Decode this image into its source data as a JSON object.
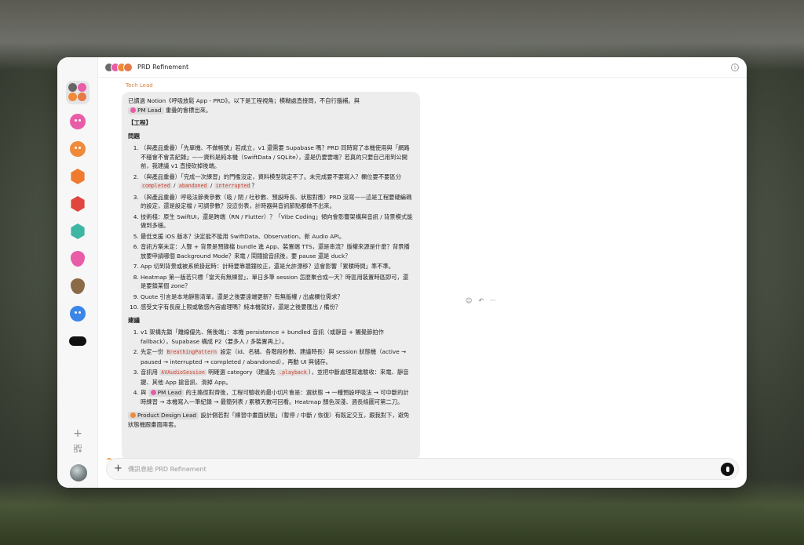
{
  "header": {
    "title": "PRD Refinement",
    "avatar_colors": [
      "#6b6b6b",
      "#e85ca8",
      "#ef8a3a",
      "#e57a45"
    ]
  },
  "sidebar": {
    "items": [
      {
        "name": "group-chat",
        "shape": "group",
        "colors": [
          "#666666",
          "#e85ca8",
          "#ef8a3a",
          "#e57a45"
        ],
        "active": true
      },
      {
        "name": "pm-lead",
        "shape": "blob",
        "color": "#e85ca8"
      },
      {
        "name": "product-design-lead",
        "shape": "blob",
        "color": "#ef8a3a"
      },
      {
        "name": "orange-hex",
        "shape": "hex",
        "color": "#ee7b2f"
      },
      {
        "name": "red-hex",
        "shape": "hex",
        "color": "#e0463e"
      },
      {
        "name": "teal-hex",
        "shape": "hex",
        "color": "#3db7a4"
      },
      {
        "name": "pink-drop",
        "shape": "drop",
        "color": "#e85ca8"
      },
      {
        "name": "brown-drop",
        "shape": "drop",
        "color": "#8b6b45"
      },
      {
        "name": "blue-blob",
        "shape": "blob",
        "color": "#3b86e8"
      },
      {
        "name": "black-pill",
        "shape": "pill",
        "color": "#111111"
      }
    ],
    "add_label": "+",
    "grid_icon": "grid-plus-icon"
  },
  "message": {
    "sender": "Tech Lead",
    "intro_before": "已讀過 Notion《呼吸放鬆 App - PRD》。以下是工程視角；模糊處直接問，不自行腦補。與",
    "intro_mention": "PM Lead",
    "intro_after": "重疊的會標出來。",
    "section_heading": "【工程】",
    "questions_heading": "問題",
    "questions": [
      [
        "（與產品重疊）「先單機、不做帳號」若成立，v1 還需要 Supabase 嗎？PRD 同時寫了本機使用與「網路不穩會不會丟紀錄」——資料是純本機（SwiftData / SQLite），還是仍要雲端？若真的只要自己用到公開前，我建議 v1 直接砍掉後端。"
      ],
      [
        "（與產品重疊）「完成一次練習」的門檻沒定，資料模型就定不了。未完成要不要寫入？欄位要不要區分 ",
        "completed",
        " / ",
        "abandoned",
        " / ",
        "interrupted",
        "？"
      ],
      [
        "（與產品重疊）呼吸法節奏參數（吸 / 閉 / 吐秒數、預設時長、狀態對應）PRD 沒寫——這是工程要硬編碼的設定，還是設定檔 / 可調參數？沒這份表，計時器與音訊節點都做不出來。"
      ],
      [
        "技術棧：原生 SwiftUI，還是跨端（RN / Flutter）？「Vibe Coding」傾向會影響架構與音訊 / 背景模式能做到多穩。"
      ],
      [
        "最低支援 iOS 版本？決定能不能用 SwiftData、Observation、新 Audio API。"
      ],
      [
        "音訊方案未定：人聲 + 背景是預錄檔 bundle 進 App、裝置端 TTS，還是串流？版權來源是什麼？背景播放要申請哪個 Background Mode？來電 / 鬧鐘搶音訊後，要 pause 還是 duck？"
      ],
      [
        "App 切到背景或被系統掛起時：計時要靠牆鐘校正，還是允許漂移？這會影響「累積時間」準不準。"
      ],
      [
        "Heatmap 第一版若只標「當天有無練習」，單日多筆 session 怎麼聚合成一天？時區用裝置時區即可，還是要鎖某個 zone？"
      ],
      [
        "Quote 引言是本地靜態清單，還是之後要遠端更新？有無版權 / 出處欄位需求？"
      ],
      [
        "感受文字有長度上限或敏感內容處理嗎？純本機就好，還是之後要匯出 / 備份？"
      ]
    ],
    "suggestions_heading": "建議",
    "suggestions": [
      [
        "v1 架構先鎖「離線優先、無後端」：本機 persistence + bundled 音訊（或靜音 + 觸覺節拍作 fallback），Supabase 構成 P2（要多人 / 多裝置再上）。"
      ],
      [
        "先定一份 ",
        "BreathingPattern",
        " 設定（id、名稱、各階段秒數、建議時長）與 session 狀態機（active → paused → interrupted → completed / abandoned），再動 UI 與儲存。"
      ],
      [
        "音訊用 ",
        "AVAudioSession",
        " 明確選 category（建議先 ",
        ".playback",
        "），並把中斷處理寫進驗收：來電、靜音鍵、其他 App 搶音訊、滑掉 App。"
      ],
      [
        "與 ",
        "@PM Lead",
        " 的主路徑對齊後，工程可驗收的最小切片會是：選狀態 → 一種預設呼吸法 → 可中斷的計時練習 → 本機寫入一筆紀錄 → 最簡列表 / 累積天數可回看。Heatmap 顏色深淺、週長條圖可第二刀。"
      ]
    ],
    "final_mention": "Product Design Lead",
    "final_text": "設計側若對「練習中畫面狀態」（暫停 / 中斷 / 恢復）有既定交互，跟我對下，避免狀態機跟畫面兩套。"
  },
  "message_actions": {
    "emoji_icon": "☺",
    "reply_icon": "↶",
    "more_icon": "···"
  },
  "scroll_down_label": "↓",
  "composer": {
    "placeholder": "傳訊息給 PRD Refinement",
    "plus_label": "+"
  },
  "colors": {
    "pm_lead": "#e85ca8",
    "design_lead": "#ef8a3a",
    "tech_lead_name": "#d8823e"
  }
}
